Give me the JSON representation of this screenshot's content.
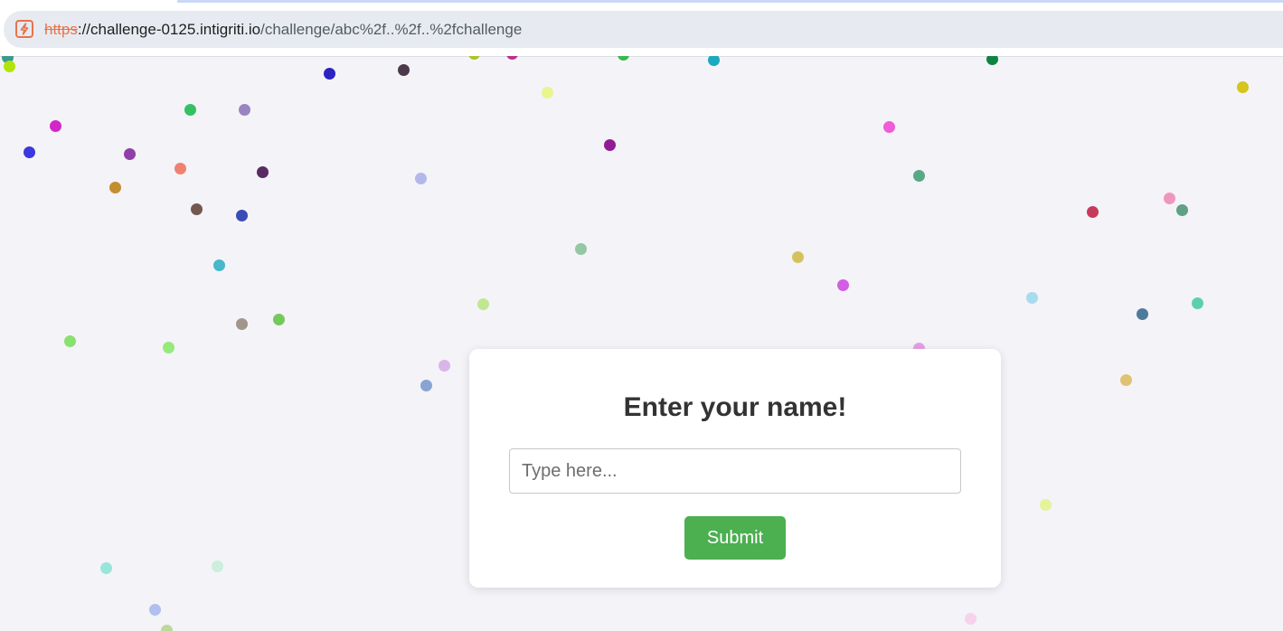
{
  "browser": {
    "url_scheme": "https",
    "url_separator": "://",
    "url_host": "challenge-0125.intigriti.io",
    "url_path": "/challenge/abc%2f..%2f..%2fchallenge",
    "site_icon": "lightning-bolt-icon",
    "accent_color": "#e8734a"
  },
  "form": {
    "title": "Enter your name!",
    "input_placeholder": "Type here...",
    "input_value": "",
    "submit_label": "Submit",
    "submit_color": "#4caf50"
  },
  "confetti_colors": [
    "#3a9a8e",
    "#b2e40a",
    "#2d23c3",
    "#4c3a4c",
    "#a9c424",
    "#bc2d8e",
    "#37b94a",
    "#1aa9bf",
    "#0e8440",
    "#e9f58f",
    "#d5c51c",
    "#d227c6",
    "#3a39dd",
    "#37c063",
    "#9b84c0",
    "#903fa8",
    "#f08170",
    "#5a2a62",
    "#c28e30",
    "#b3b8ea",
    "#911d94",
    "#f05bd7",
    "#58a887",
    "#735850",
    "#3c4cb5",
    "#c63b5c",
    "#ef96bd",
    "#5fa183",
    "#46b8cb",
    "#94c7a2",
    "#d6c25c",
    "#d15ee4",
    "#a1958c",
    "#75c85c",
    "#c0e791",
    "#a8dbed",
    "#4d7b9b",
    "#5dcfae",
    "#8ae06f",
    "#95ea79",
    "#e59fe6",
    "#d8b6ea",
    "#8aa3d4",
    "#e0c274",
    "#e5f39b",
    "#98e5da",
    "#cbeedd",
    "#b1bfee",
    "#bad99a",
    "#f6d2ec"
  ]
}
